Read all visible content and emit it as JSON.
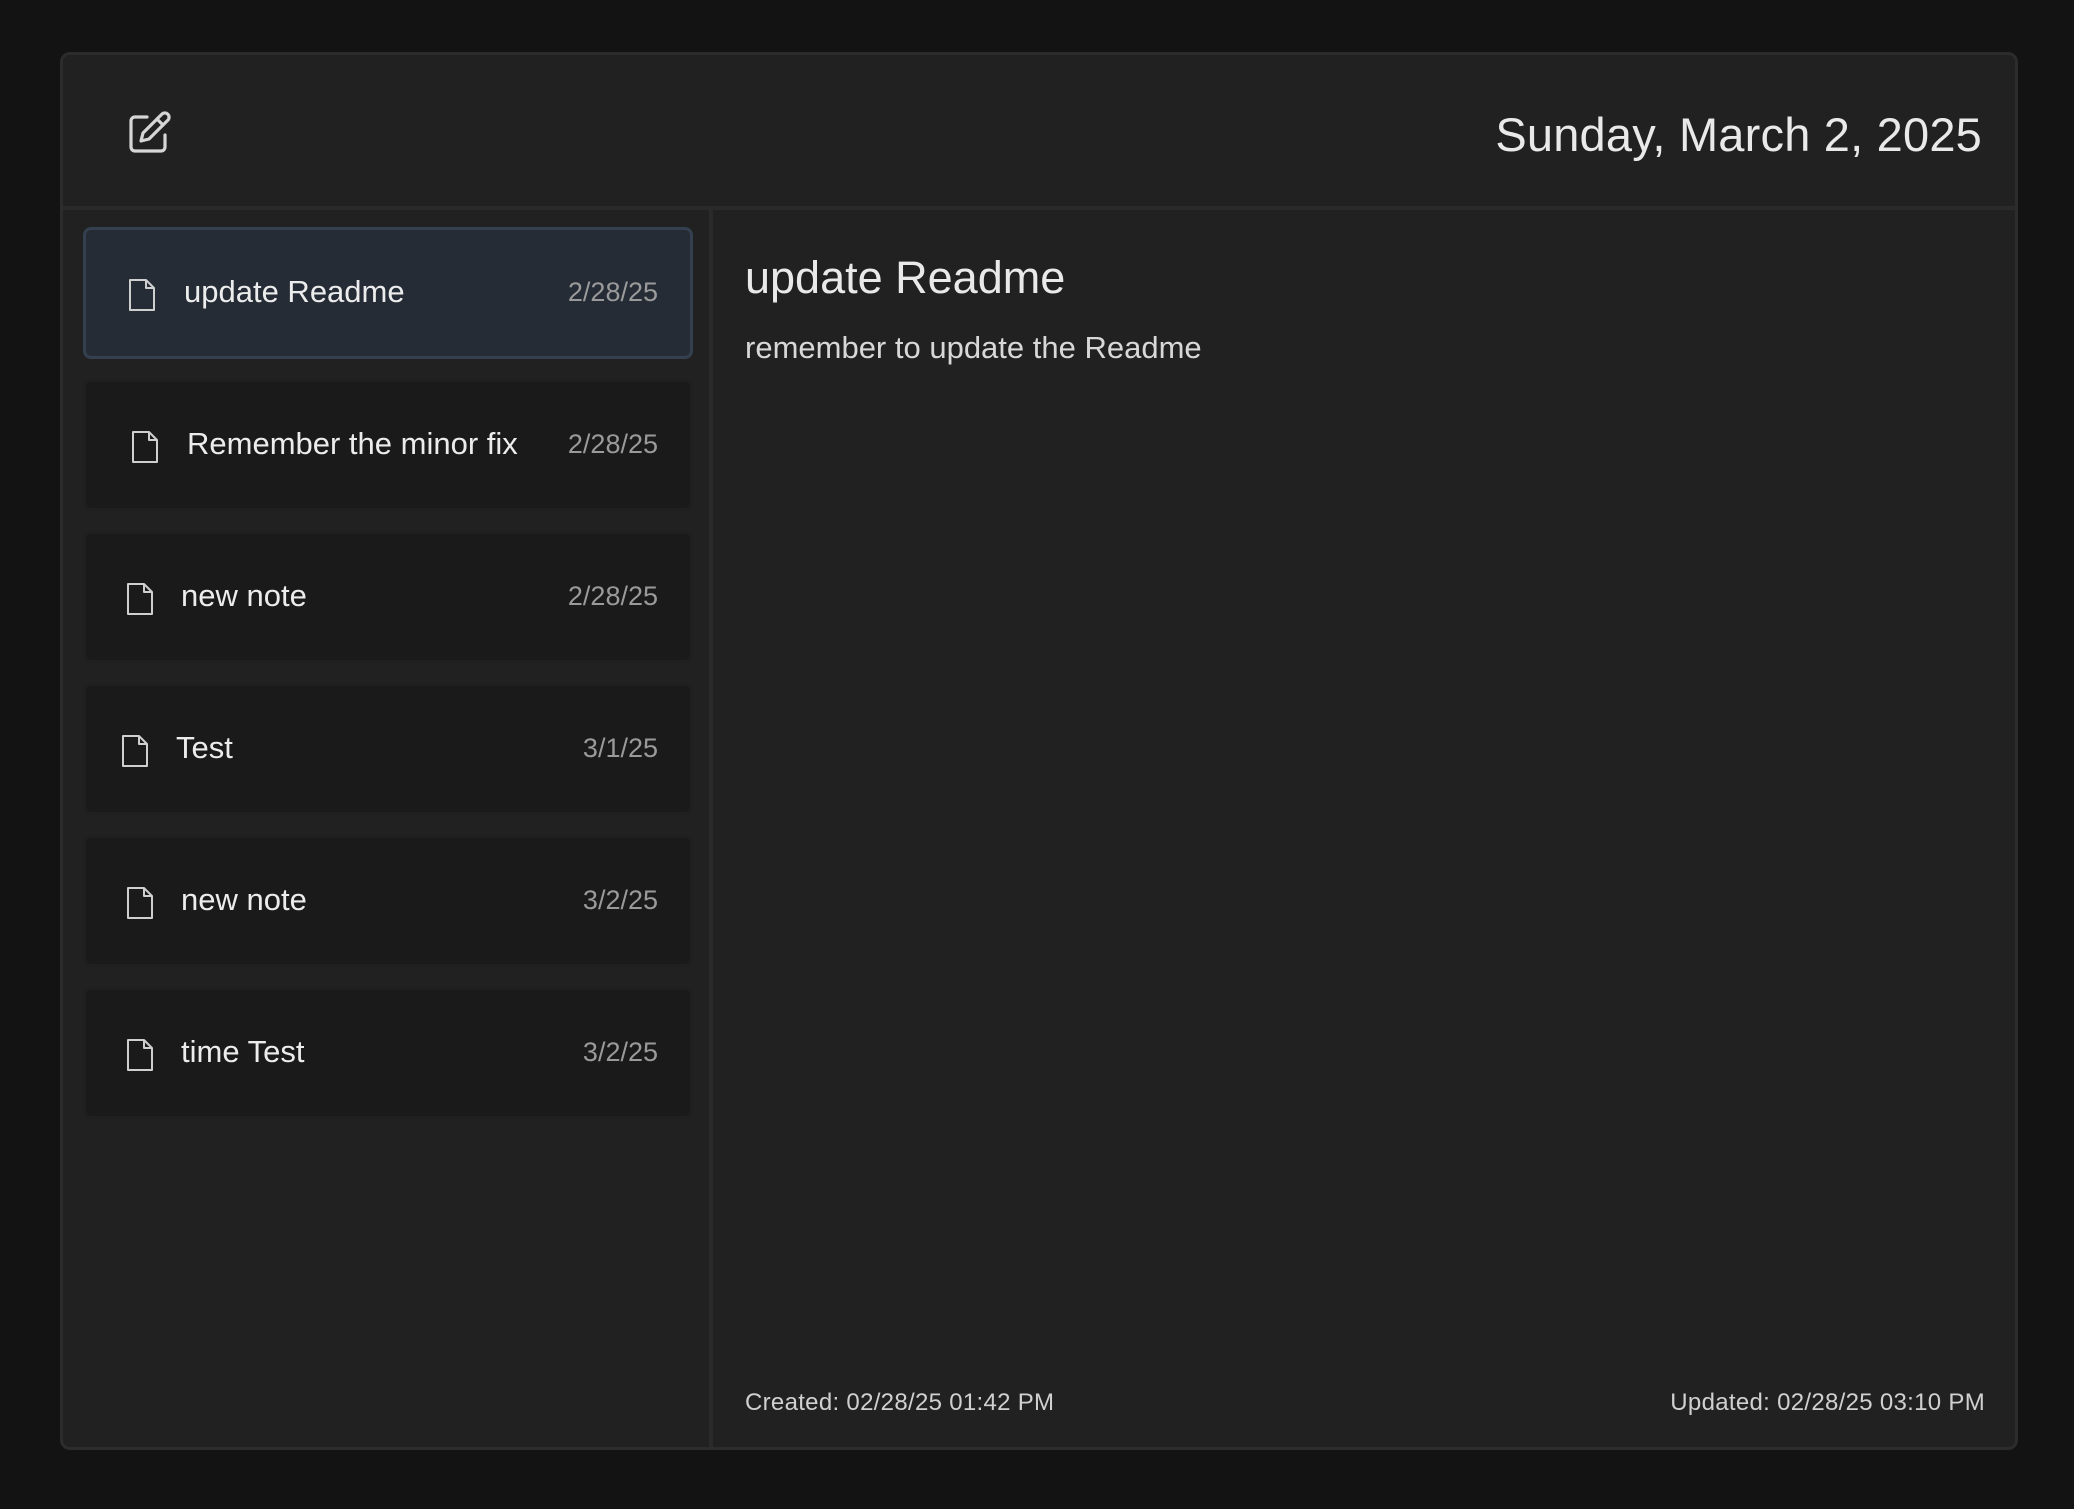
{
  "header": {
    "compose_icon": "compose-icon",
    "date": "Sunday, March 2, 2025"
  },
  "sidebar": {
    "notes": [
      {
        "title": "update Readme",
        "date": "2/28/25",
        "icon": "file-icon",
        "selected": true
      },
      {
        "title": "Remember the minor fix",
        "date": "2/28/25",
        "icon": "file-icon",
        "selected": false
      },
      {
        "title": "new note",
        "date": "2/28/25",
        "icon": "file-icon",
        "selected": false
      },
      {
        "title": "Test",
        "date": "3/1/25",
        "icon": "file-icon",
        "selected": false
      },
      {
        "title": "new note",
        "date": "3/2/25",
        "icon": "file-icon",
        "selected": false
      },
      {
        "title": "time Test",
        "date": "3/2/25",
        "icon": "file-icon",
        "selected": false
      }
    ]
  },
  "note": {
    "title": "update Readme",
    "body": "remember to update the Readme",
    "created": "Created: 02/28/25 01:42 PM",
    "updated": "Updated: 02/28/25 03:10 PM"
  },
  "colors": {
    "background": "#131313",
    "panel": "#212121",
    "item": "#1a1a1a",
    "selected_item": "#252c36",
    "selected_border": "#34404f"
  }
}
